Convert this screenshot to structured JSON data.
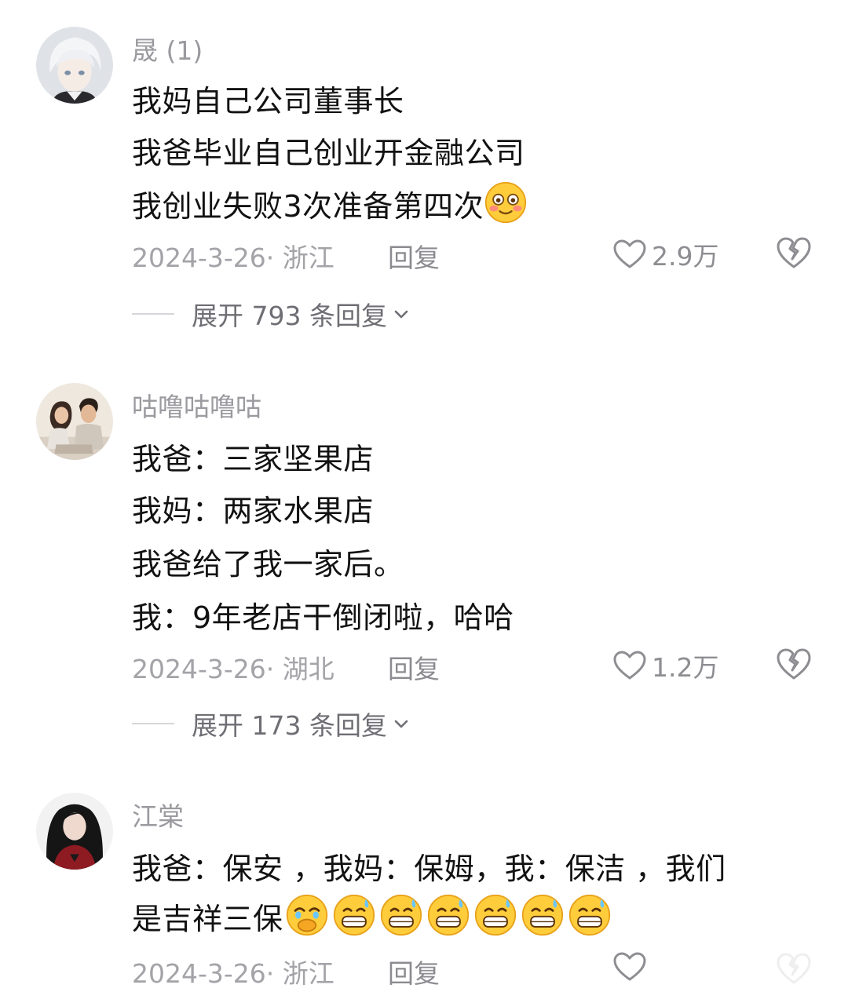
{
  "comments": [
    {
      "username": "晟 (1)",
      "lines": [
        "我妈自己公司董事长",
        "我爸毕业自己创业开金融公司",
        "我创业失败3次准备第四次"
      ],
      "date_location": "2024-3-26· 浙江",
      "reply": "回复",
      "likes": "2.9万",
      "expand": "展开 793 条回复"
    },
    {
      "username": "咕噜咕噜咕",
      "lines": [
        "我爸：三家坚果店",
        "我妈：两家水果店",
        "我爸给了我一家后。",
        "我：9年老店干倒闭啦，哈哈"
      ],
      "date_location": "2024-3-26· 湖北",
      "reply": "回复",
      "likes": "1.2万",
      "expand": "展开 173 条回复"
    },
    {
      "username": "江棠",
      "lines": [
        "我爸：保安 ，我妈：保姆，我：保洁      ，我们",
        "是吉祥三保"
      ],
      "date_location": "2024-3-26· 浙江",
      "reply": "回复"
    }
  ],
  "icons": {
    "like": "heart-outline-icon",
    "dislike": "broken-heart-icon",
    "expand": "chevron-down-icon",
    "emoji_1": "blushing-smile-emoji",
    "emoji_2": "crying-covering-mouth-emoji",
    "emoji_3": "grinning-sweat-emoji"
  },
  "colors": {
    "text_primary": "#121212",
    "text_secondary": "#9a9a9f",
    "background": "#ffffff"
  }
}
